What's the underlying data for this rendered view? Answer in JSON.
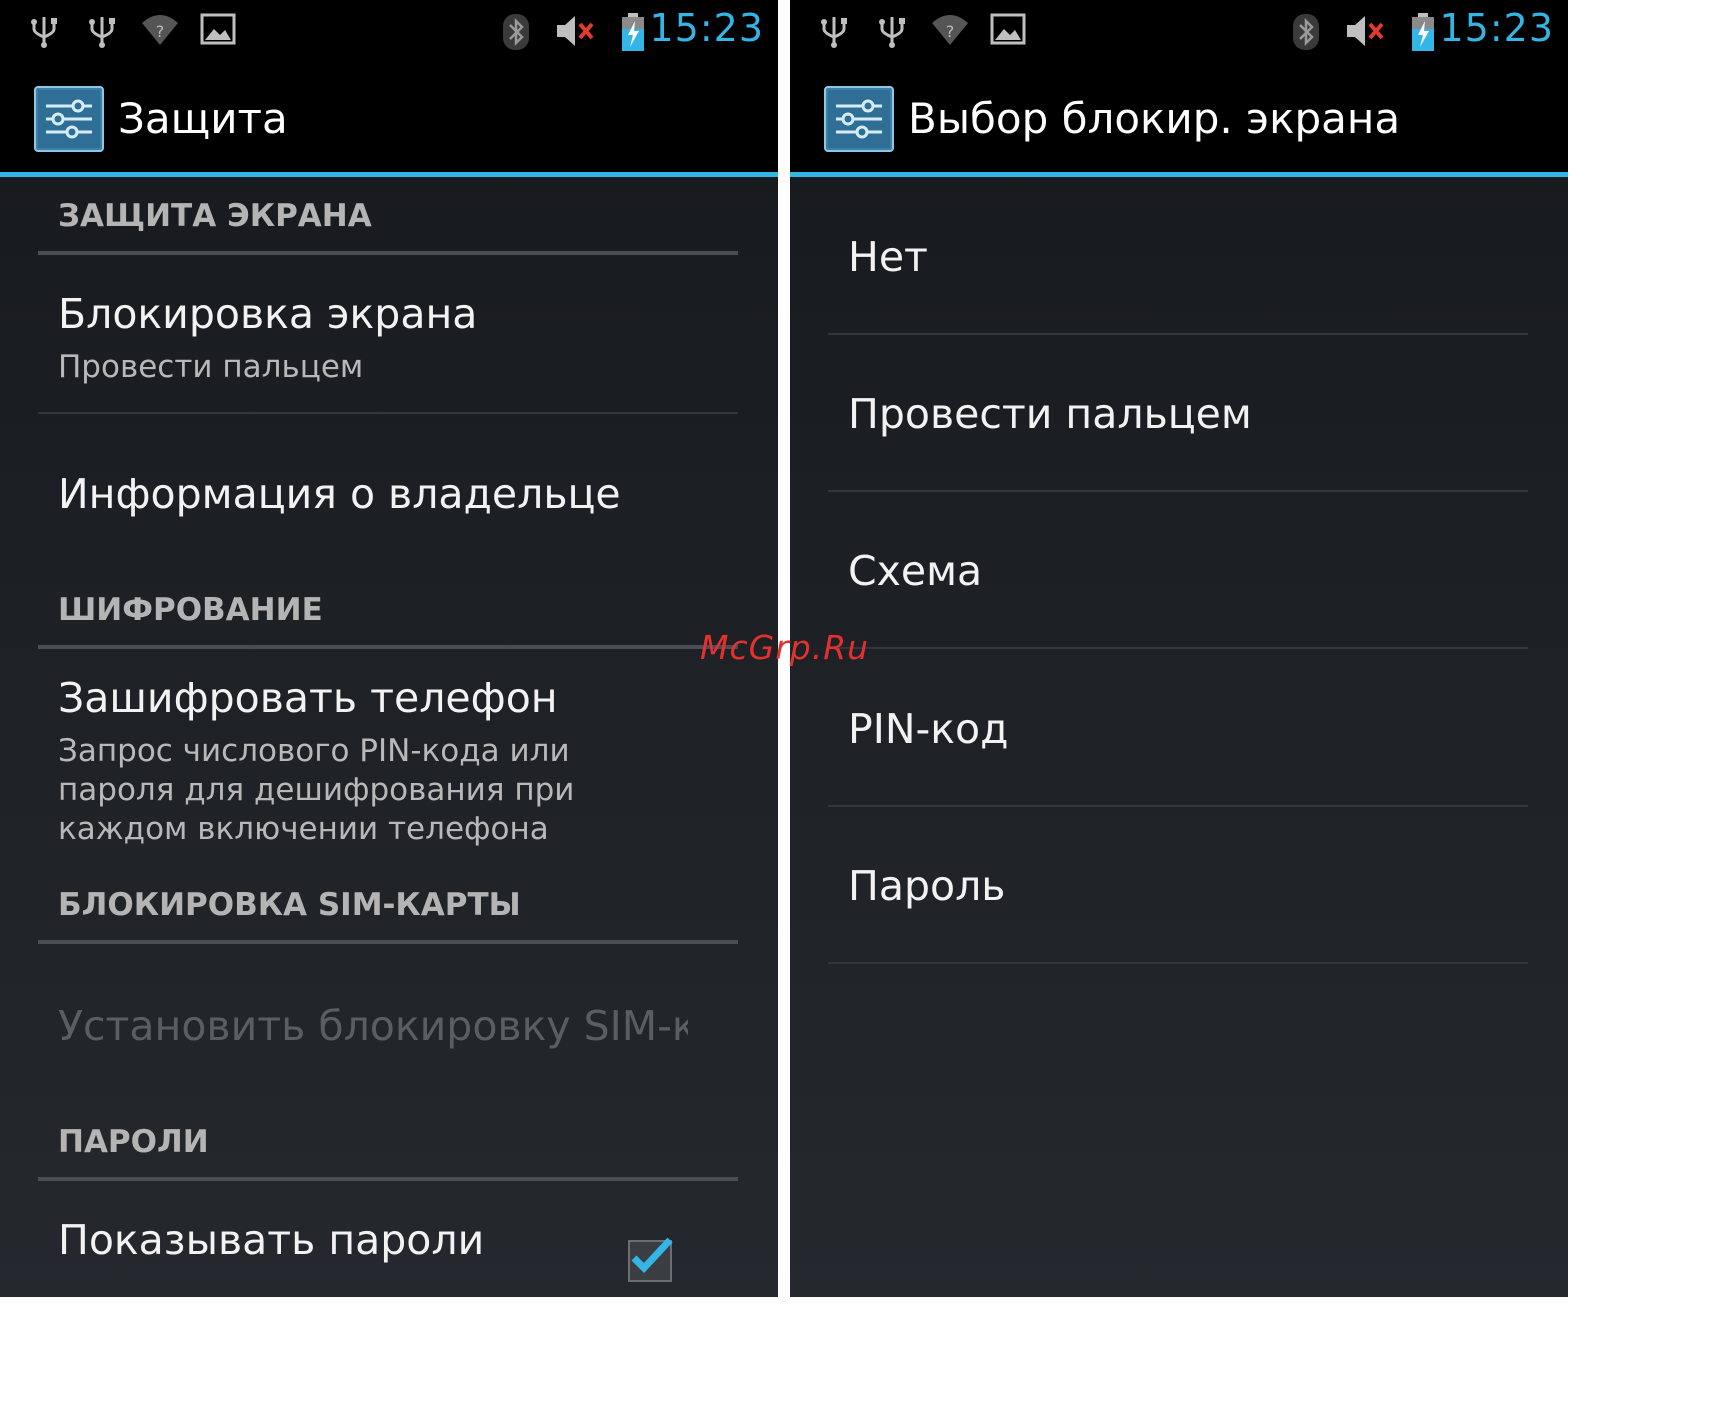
{
  "status_bar": {
    "time": "15:23"
  },
  "colors": {
    "accent": "#33b5e5",
    "watermark": "#e3312f"
  },
  "left": {
    "title": "Защита",
    "sections": {
      "screen_security": "ЗАЩИТА ЭКРАНА",
      "encryption": "ШИФРОВАНИЕ",
      "sim_lock": "БЛОКИРОВКА SIM-КАРТЫ",
      "passwords": "ПАРОЛИ"
    },
    "items": {
      "screen_lock": {
        "title": "Блокировка экрана",
        "summary": "Провести пальцем"
      },
      "owner_info": {
        "title": "Информация о владельце"
      },
      "encrypt_phone": {
        "title": "Зашифровать телефон",
        "summary_lines": [
          "Запрос числового PIN-кода или",
          "пароля для дешифрования при",
          "каждом включении телефона"
        ]
      },
      "sim_lock": {
        "title": "Установить блокировку SIM-к"
      },
      "show_passwords": {
        "title": "Показывать пароли",
        "checked": true
      }
    }
  },
  "right": {
    "title": "Выбор блокир. экрана",
    "options": [
      "Нет",
      "Провести пальцем",
      "Схема",
      "PIN-код",
      "Пароль"
    ]
  },
  "watermark": "McGrp.Ru",
  "icons": [
    "usb-icon",
    "usb-icon",
    "wifi-unknown-icon",
    "picture-icon",
    "bluetooth-icon",
    "volume-muted-icon",
    "battery-charging-icon",
    "settings-app-icon",
    "checkbox-check-icon"
  ]
}
